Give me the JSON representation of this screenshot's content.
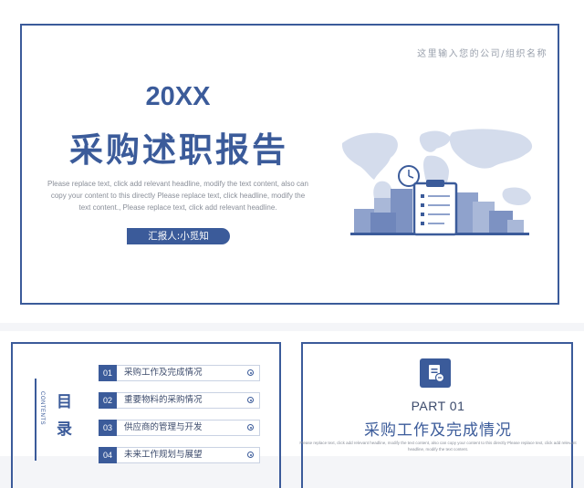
{
  "cover": {
    "company": "这里输入您的公司/组织名称",
    "year": "20XX",
    "title": "采购述职报告",
    "description": "Please replace text, click add relevant headline, modify the text content, also can copy your content to this directly Please replace text, click headline, modify the text content., Please replace text, click add relevant headline.",
    "reporter": "汇报人:小觅知",
    "illustration_icon": "procurement-clipboard-world-map"
  },
  "toc": {
    "title_cn": "目录",
    "title_en": "CONTENTS",
    "items": [
      {
        "num": "01",
        "label": "采购工作及完成情况"
      },
      {
        "num": "02",
        "label": "重要物料的采购情况"
      },
      {
        "num": "03",
        "label": "供应商的管理与开发"
      },
      {
        "num": "04",
        "label": "未来工作规划与展望"
      }
    ]
  },
  "part": {
    "icon": "document-icon",
    "number": "PART 01",
    "title": "采购工作及完成情况",
    "description": "Please replace text, click add relevant headline, modify the text content, also can copy your content to this directly Please replace text, click add relevant headline, modify the text content."
  },
  "colors": {
    "primary": "#3b5b9a",
    "light": "#c9d2e3",
    "text_gray": "#8a8f99"
  }
}
